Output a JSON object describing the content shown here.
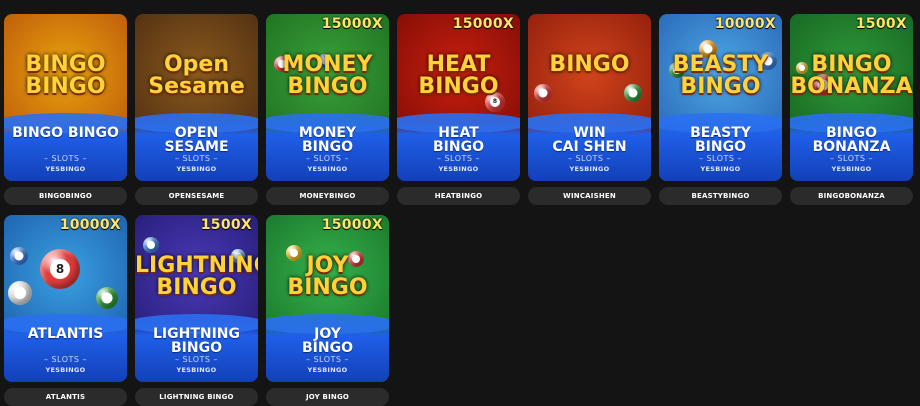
{
  "games": [
    {
      "label": "BINGOBINGO",
      "title": "BINGO BINGO",
      "logo": "BINGO\nBINGO",
      "category": "– SLOTS –",
      "provider": "YESBINGO",
      "multiplier": "",
      "bg": "#e8a30e",
      "bg2": "#b8520a"
    },
    {
      "label": "OPENSESAME",
      "title": "OPEN\nSESAME",
      "logo": "Open\nSesame",
      "category": "– SLOTS –",
      "provider": "YESBINGO",
      "multiplier": "",
      "bg": "#8a5a1e",
      "bg2": "#4a2a10"
    },
    {
      "label": "MONEYBINGO",
      "title": "MONEY\nBINGO",
      "logo": "MONEY\nBINGO",
      "category": "– SLOTS –",
      "provider": "YESBINGO",
      "multiplier": "15000X",
      "bg": "#3aa23a",
      "bg2": "#1c6b1c"
    },
    {
      "label": "HEATBINGO",
      "title": "HEAT\nBINGO",
      "logo": "HEAT\nBINGO",
      "category": "– SLOTS –",
      "provider": "YESBINGO",
      "multiplier": "15000X",
      "bg": "#c81f0e",
      "bg2": "#7a0b05"
    },
    {
      "label": "WINCAISHEN",
      "title": "WIN\nCAI SHEN",
      "logo": "BINGO",
      "category": "– SLOTS –",
      "provider": "YESBINGO",
      "multiplier": "",
      "bg": "#d2441c",
      "bg2": "#8a1a0a"
    },
    {
      "label": "BEASTYBINGO",
      "title": "BEASTY\nBINGO",
      "logo": "BEASTY\nBINGO",
      "category": "– SLOTS –",
      "provider": "YESBINGO",
      "multiplier": "10000X",
      "bg": "#4fa8e8",
      "bg2": "#2460b0"
    },
    {
      "label": "BINGOBONANZA",
      "title": "BINGO\nBONANZA",
      "logo": "BINGO\nBONANZA",
      "category": "– SLOTS –",
      "provider": "YESBINGO",
      "multiplier": "1500X",
      "bg": "#2f9a3a",
      "bg2": "#146020"
    },
    {
      "label": "ATLANTIS",
      "title": "ATLANTIS",
      "logo": "",
      "category": "– SLOTS –",
      "provider": "YESBINGO",
      "multiplier": "10000X",
      "bg": "#3aa0e0",
      "bg2": "#1a5aa8"
    },
    {
      "label": "LIGHTNING BINGO",
      "title": "LIGHTNING\nBINGO",
      "logo": "LIGHTNING\nBINGO",
      "category": "– SLOTS –",
      "provider": "YESBINGO",
      "multiplier": "1500X",
      "bg": "#4a3ab8",
      "bg2": "#221a70"
    },
    {
      "label": "JOY BINGO",
      "title": "JOY\nBINGO",
      "logo": "JOY\nBINGO",
      "category": "– SLOTS –",
      "provider": "YESBINGO",
      "multiplier": "15000X",
      "bg": "#36b24a",
      "bg2": "#16702a"
    }
  ]
}
